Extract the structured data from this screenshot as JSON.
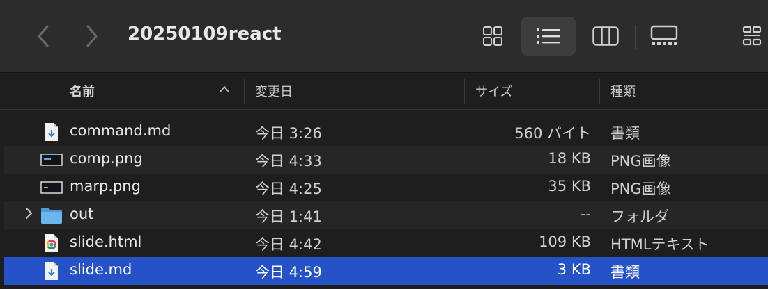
{
  "toolbar": {
    "title": "20250109react",
    "back_icon": "chevron-left-icon",
    "forward_icon": "chevron-right-icon",
    "active_view": "list"
  },
  "columns": {
    "name": "名前",
    "date": "変更日",
    "size": "サイズ",
    "kind": "種類",
    "sort_indicator": "^"
  },
  "files": [
    {
      "name": "command.md",
      "date": "今日 3:26",
      "size": "560 バイト",
      "kind": "書類",
      "icon": "markdown-doc-icon"
    },
    {
      "name": "comp.png",
      "date": "今日 4:33",
      "size": "18 KB",
      "kind": "PNG画像",
      "icon": "png-thumbnail-icon"
    },
    {
      "name": "marp.png",
      "date": "今日 4:25",
      "size": "35 KB",
      "kind": "PNG画像",
      "icon": "png-thumbnail-icon"
    },
    {
      "name": "out",
      "date": "今日 1:41",
      "size": "--",
      "kind": "フォルダ",
      "icon": "folder-icon",
      "disclosure": "›"
    },
    {
      "name": "slide.html",
      "date": "今日 4:42",
      "size": "109 KB",
      "kind": "HTMLテキスト",
      "icon": "chrome-html-icon"
    },
    {
      "name": "slide.md",
      "date": "今日 4:59",
      "size": "3 KB",
      "kind": "書類",
      "icon": "markdown-doc-icon",
      "selected": true
    }
  ],
  "colors": {
    "selection": "#2553c7",
    "toolbar_bg": "#2c2c2c",
    "window_bg": "#1e1e1e",
    "folder": "#5aa9e6"
  }
}
